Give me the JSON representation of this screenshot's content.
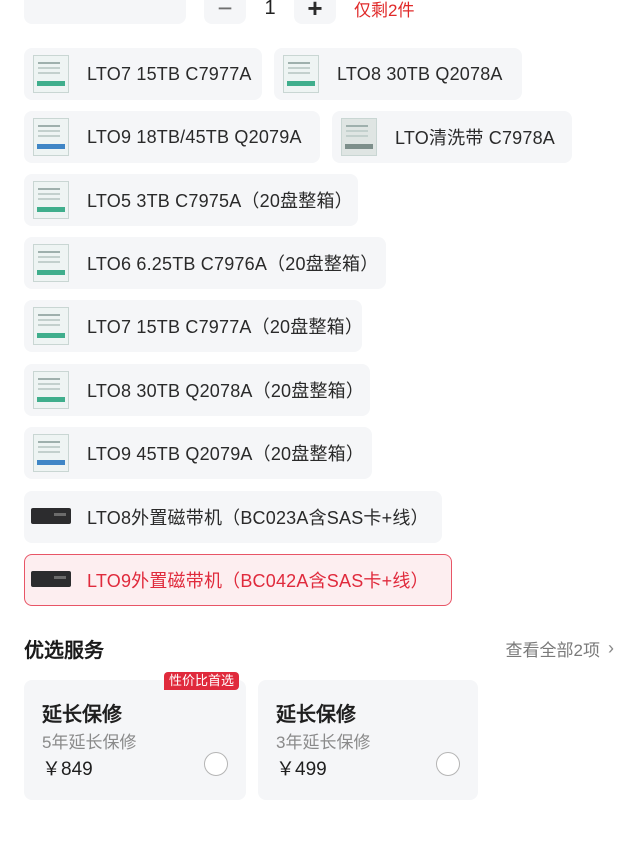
{
  "purchase": {
    "quantity": "1",
    "minus_symbol": "−",
    "plus_symbol": "+",
    "stock_note": "仅剩2件"
  },
  "options": [
    {
      "label": "LTO7 15TB C7977A",
      "icon": "tape-cartridge-icon"
    },
    {
      "label": "LTO8 30TB Q2078A",
      "icon": "tape-cartridge-icon"
    },
    {
      "label": "LTO9 18TB/45TB Q2079A",
      "icon": "tape-cartridge-icon"
    },
    {
      "label": "LTO清洗带 C7978A",
      "icon": "cleaning-tape-icon"
    },
    {
      "label": "LTO5 3TB C7975A（20盘整箱）",
      "icon": "tape-cartridge-icon"
    },
    {
      "label": "LTO6 6.25TB C7976A（20盘整箱）",
      "icon": "tape-cartridge-icon"
    },
    {
      "label": "LTO7 15TB C7977A（20盘整箱）",
      "icon": "tape-cartridge-icon"
    },
    {
      "label": "LTO8 30TB Q2078A（20盘整箱）",
      "icon": "tape-cartridge-icon"
    },
    {
      "label": "LTO9 45TB Q2079A（20盘整箱）",
      "icon": "tape-cartridge-icon"
    },
    {
      "label": "LTO8外置磁带机（BC023A含SAS卡+线）",
      "icon": "tape-drive-icon"
    },
    {
      "label": "LTO9外置磁带机（BC042A含SAS卡+线）",
      "icon": "tape-drive-icon",
      "selected": true
    }
  ],
  "services": {
    "title": "优选服务",
    "view_all": "查看全部2项",
    "items": [
      {
        "title": "延长保修",
        "subtitle": "5年延长保修",
        "price": "￥849",
        "badge": "性价比首选"
      },
      {
        "title": "延长保修",
        "subtitle": "3年延长保修",
        "price": "￥499"
      }
    ]
  },
  "colors": {
    "accent": "#e02a3c",
    "card_bg": "#f5f6f8",
    "selected_bg": "#fdeef0"
  }
}
